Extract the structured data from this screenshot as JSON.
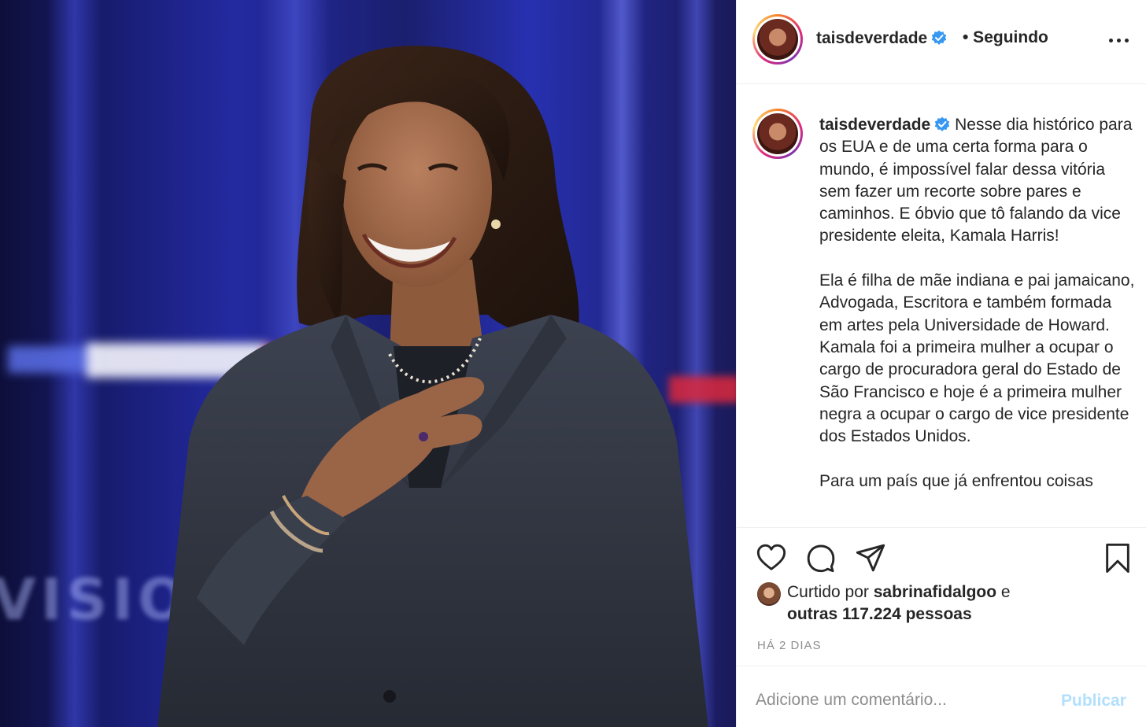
{
  "post_image": {
    "alt_icon": "photo-of-smiling-woman"
  },
  "header": {
    "username": "taisdeverdade",
    "verified_icon": "verified-badge-icon",
    "follow_status": "• Seguindo",
    "more_icon": "more-options-icon"
  },
  "caption": {
    "username": "taisdeverdade",
    "paragraphs": [
      "Nesse dia histórico para os EUA e de uma certa forma para o mundo, é impossível falar dessa vitória sem fazer um recorte sobre pares e caminhos. E óbvio que tô falando da vice presidente eleita, Kamala Harris!",
      "Ela é filha de mãe indiana e pai jamaicano, Advogada, Escritora e também formada em artes pela Universidade de Howard. Kamala foi a primeira mulher a ocupar o cargo de procuradora geral do Estado de São Francisco e hoje é a primeira mulher negra a ocupar o cargo de vice presidente dos Estados Unidos.",
      "Para um país que já enfrentou coisas"
    ]
  },
  "actions": {
    "like_icon": "heart-icon",
    "comment_icon": "comment-icon",
    "share_icon": "share-icon",
    "save_icon": "bookmark-icon"
  },
  "likes": {
    "prefix": "Curtido por ",
    "user": "sabrinafidalgoo",
    "conjunction": " e",
    "others": "outras 117.224 pessoas"
  },
  "timestamp": "HÁ 2 DIAS",
  "comment": {
    "placeholder": "Adicione um comentário...",
    "publish_label": "Publicar"
  },
  "colors": {
    "verified": "#3897f0",
    "publish_disabled": "#b2dffc",
    "muted": "#8e8e8e",
    "text": "#262626"
  }
}
